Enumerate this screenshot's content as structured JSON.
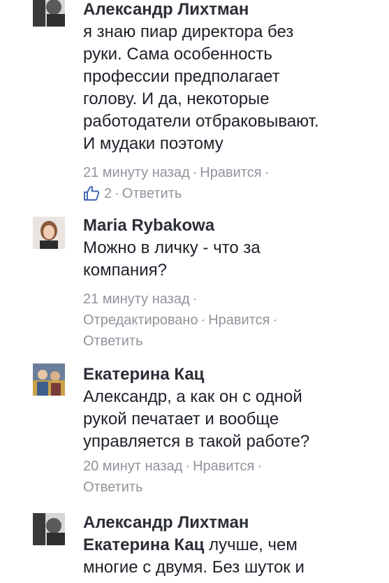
{
  "comments": [
    {
      "author": "Александр Лихтман",
      "text_lines": [
        "я знаю пиар директора без",
        "руки. Сама особенность",
        "профессии предполагает",
        "голову. И да, некоторые",
        "работодатели отбраковывают.",
        "И мудаки поэтому"
      ],
      "time": "21 минуту назад",
      "like_label": "Нравится",
      "like_count": "2",
      "reply_label": "Ответить"
    },
    {
      "author": "Maria Rybakowa",
      "text_lines": [
        "Можно в личку - что за",
        "компания?"
      ],
      "time": "21 минуту назад",
      "edited_label": "Отредактировано",
      "like_label": "Нравится",
      "reply_label": "Ответить"
    },
    {
      "author": "Екатерина Кац",
      "text_lines": [
        "Александр, а как он с одной",
        "рукой печатает и вообще",
        "управляется в такой работе?"
      ],
      "time": "20 минут назад",
      "like_label": "Нравится",
      "reply_label": "Ответить"
    },
    {
      "author": "Александр Лихтман",
      "reply_to": "Екатерина Кац",
      "text_line1_after_mention": " лучше, чем",
      "text_line2": "многие с двумя. Без шуток и"
    }
  ],
  "separator": "·",
  "colors": {
    "author": "#2b2e36",
    "text": "#1d2129",
    "meta": "#90949c",
    "like_icon": "#4267b2"
  },
  "icons": {
    "like": "thumbs-up-icon"
  }
}
